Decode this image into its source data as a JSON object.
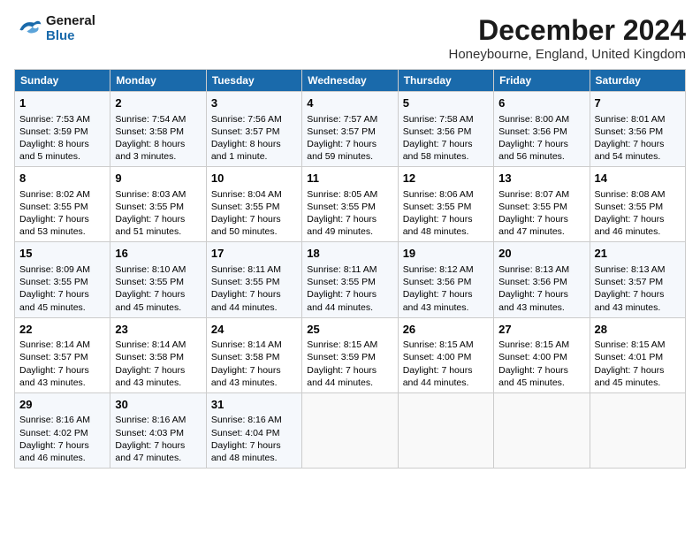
{
  "logo": {
    "line1": "General",
    "line2": "Blue"
  },
  "title": "December 2024",
  "subtitle": "Honeybourne, England, United Kingdom",
  "days_of_week": [
    "Sunday",
    "Monday",
    "Tuesday",
    "Wednesday",
    "Thursday",
    "Friday",
    "Saturday"
  ],
  "weeks": [
    [
      {
        "day": "1",
        "info": "Sunrise: 7:53 AM\nSunset: 3:59 PM\nDaylight: 8 hours\nand 5 minutes."
      },
      {
        "day": "2",
        "info": "Sunrise: 7:54 AM\nSunset: 3:58 PM\nDaylight: 8 hours\nand 3 minutes."
      },
      {
        "day": "3",
        "info": "Sunrise: 7:56 AM\nSunset: 3:57 PM\nDaylight: 8 hours\nand 1 minute."
      },
      {
        "day": "4",
        "info": "Sunrise: 7:57 AM\nSunset: 3:57 PM\nDaylight: 7 hours\nand 59 minutes."
      },
      {
        "day": "5",
        "info": "Sunrise: 7:58 AM\nSunset: 3:56 PM\nDaylight: 7 hours\nand 58 minutes."
      },
      {
        "day": "6",
        "info": "Sunrise: 8:00 AM\nSunset: 3:56 PM\nDaylight: 7 hours\nand 56 minutes."
      },
      {
        "day": "7",
        "info": "Sunrise: 8:01 AM\nSunset: 3:56 PM\nDaylight: 7 hours\nand 54 minutes."
      }
    ],
    [
      {
        "day": "8",
        "info": "Sunrise: 8:02 AM\nSunset: 3:55 PM\nDaylight: 7 hours\nand 53 minutes."
      },
      {
        "day": "9",
        "info": "Sunrise: 8:03 AM\nSunset: 3:55 PM\nDaylight: 7 hours\nand 51 minutes."
      },
      {
        "day": "10",
        "info": "Sunrise: 8:04 AM\nSunset: 3:55 PM\nDaylight: 7 hours\nand 50 minutes."
      },
      {
        "day": "11",
        "info": "Sunrise: 8:05 AM\nSunset: 3:55 PM\nDaylight: 7 hours\nand 49 minutes."
      },
      {
        "day": "12",
        "info": "Sunrise: 8:06 AM\nSunset: 3:55 PM\nDaylight: 7 hours\nand 48 minutes."
      },
      {
        "day": "13",
        "info": "Sunrise: 8:07 AM\nSunset: 3:55 PM\nDaylight: 7 hours\nand 47 minutes."
      },
      {
        "day": "14",
        "info": "Sunrise: 8:08 AM\nSunset: 3:55 PM\nDaylight: 7 hours\nand 46 minutes."
      }
    ],
    [
      {
        "day": "15",
        "info": "Sunrise: 8:09 AM\nSunset: 3:55 PM\nDaylight: 7 hours\nand 45 minutes."
      },
      {
        "day": "16",
        "info": "Sunrise: 8:10 AM\nSunset: 3:55 PM\nDaylight: 7 hours\nand 45 minutes."
      },
      {
        "day": "17",
        "info": "Sunrise: 8:11 AM\nSunset: 3:55 PM\nDaylight: 7 hours\nand 44 minutes."
      },
      {
        "day": "18",
        "info": "Sunrise: 8:11 AM\nSunset: 3:55 PM\nDaylight: 7 hours\nand 44 minutes."
      },
      {
        "day": "19",
        "info": "Sunrise: 8:12 AM\nSunset: 3:56 PM\nDaylight: 7 hours\nand 43 minutes."
      },
      {
        "day": "20",
        "info": "Sunrise: 8:13 AM\nSunset: 3:56 PM\nDaylight: 7 hours\nand 43 minutes."
      },
      {
        "day": "21",
        "info": "Sunrise: 8:13 AM\nSunset: 3:57 PM\nDaylight: 7 hours\nand 43 minutes."
      }
    ],
    [
      {
        "day": "22",
        "info": "Sunrise: 8:14 AM\nSunset: 3:57 PM\nDaylight: 7 hours\nand 43 minutes."
      },
      {
        "day": "23",
        "info": "Sunrise: 8:14 AM\nSunset: 3:58 PM\nDaylight: 7 hours\nand 43 minutes."
      },
      {
        "day": "24",
        "info": "Sunrise: 8:14 AM\nSunset: 3:58 PM\nDaylight: 7 hours\nand 43 minutes."
      },
      {
        "day": "25",
        "info": "Sunrise: 8:15 AM\nSunset: 3:59 PM\nDaylight: 7 hours\nand 44 minutes."
      },
      {
        "day": "26",
        "info": "Sunrise: 8:15 AM\nSunset: 4:00 PM\nDaylight: 7 hours\nand 44 minutes."
      },
      {
        "day": "27",
        "info": "Sunrise: 8:15 AM\nSunset: 4:00 PM\nDaylight: 7 hours\nand 45 minutes."
      },
      {
        "day": "28",
        "info": "Sunrise: 8:15 AM\nSunset: 4:01 PM\nDaylight: 7 hours\nand 45 minutes."
      }
    ],
    [
      {
        "day": "29",
        "info": "Sunrise: 8:16 AM\nSunset: 4:02 PM\nDaylight: 7 hours\nand 46 minutes."
      },
      {
        "day": "30",
        "info": "Sunrise: 8:16 AM\nSunset: 4:03 PM\nDaylight: 7 hours\nand 47 minutes."
      },
      {
        "day": "31",
        "info": "Sunrise: 8:16 AM\nSunset: 4:04 PM\nDaylight: 7 hours\nand 48 minutes."
      },
      {
        "day": "",
        "info": ""
      },
      {
        "day": "",
        "info": ""
      },
      {
        "day": "",
        "info": ""
      },
      {
        "day": "",
        "info": ""
      }
    ]
  ]
}
